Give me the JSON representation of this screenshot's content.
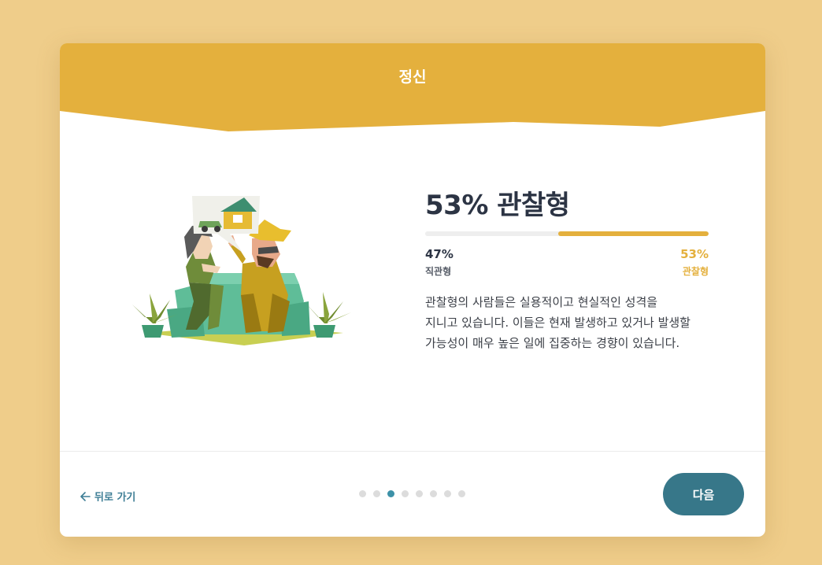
{
  "header": {
    "title": "정신"
  },
  "result": {
    "title": "53% 관찰형",
    "progress_fraction": 0.53,
    "left_percent": "47%",
    "left_label": "직관형",
    "right_percent": "53%",
    "right_label": "관찰형",
    "description_lines": [
      "관찰형의 사람들은 실용적이고 현실적인 성격을",
      "지니고 있습니다. 이들은 현재 발생하고 있거나 발생할",
      "가능성이 매우 높은 일에 집중하는 경향이 있습니다."
    ]
  },
  "footer": {
    "back_label": "뒤로 가기",
    "next_label": "다음",
    "page_count": 8,
    "current_page": 3
  },
  "colors": {
    "background": "#efcd8a",
    "header": "#e4b03d",
    "accent": "#e4b03d",
    "button": "#377789",
    "active_dot": "#3d91a8"
  }
}
